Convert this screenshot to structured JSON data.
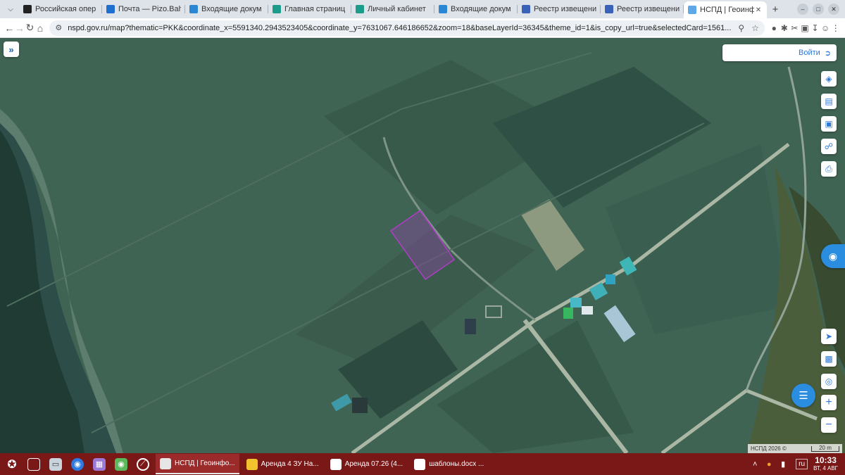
{
  "browser": {
    "tabs": [
      {
        "title": "Российская опер",
        "favicon_color": "#222222",
        "active": false
      },
      {
        "title": "Почта — Pizo.Bah",
        "favicon_color": "#1f6fd1",
        "active": false
      },
      {
        "title": "Входящие докум",
        "favicon_color": "#2b87d3",
        "active": false
      },
      {
        "title": "Главная страниц",
        "favicon_color": "#1c9c8a",
        "active": false
      },
      {
        "title": "Личный кабинет",
        "favicon_color": "#1c9c8a",
        "active": false
      },
      {
        "title": "Входящие докум",
        "favicon_color": "#2b87d3",
        "active": false
      },
      {
        "title": "Реестр извещени",
        "favicon_color": "#3a62b8",
        "active": false
      },
      {
        "title": "Реестр извещени",
        "favicon_color": "#3a62b8",
        "active": false
      },
      {
        "title": "НСПД | Геоинфор",
        "favicon_color": "#5fa8e8",
        "active": true
      }
    ],
    "url": "nspd.gov.ru/map?thematic=PKK&coordinate_x=5591340.2943523405&coordinate_y=7631067.646186652&zoom=18&baseLayerId=36345&theme_id=1&is_copy_url=true&selectedCard=1561..."
  },
  "map": {
    "login_label": "Войти",
    "attribution": "НСПД 2026 ©",
    "scale_label": "20 m",
    "tools": [
      "layers-icon",
      "ruler-icon",
      "select-area-icon",
      "share-icon",
      "print-icon"
    ],
    "nav_tools": [
      "locate-arrow-icon",
      "basemap-icon",
      "geolocation-icon"
    ],
    "zoom_in": "+",
    "zoom_out": "−",
    "accent": "#2a8de0",
    "selection_color": "#b03cc8"
  },
  "taskbar": {
    "tasks": [
      {
        "label": "НСПД | Геоинфо...",
        "icon_color": "#e6e6e6",
        "active": true
      },
      {
        "label": "Аренда 4 ЗУ На...",
        "icon_color": "#f2c12e",
        "active": false
      },
      {
        "label": "Аренда 07.26 (4...",
        "icon_color": "#ffffff",
        "active": false
      },
      {
        "label": "шаблоны.docx ...",
        "icon_color": "#ffffff",
        "active": false
      }
    ],
    "lang": "ru",
    "time": "10:33",
    "date": "ВТ, 4 АВГ",
    "accent": "#7a1717"
  }
}
